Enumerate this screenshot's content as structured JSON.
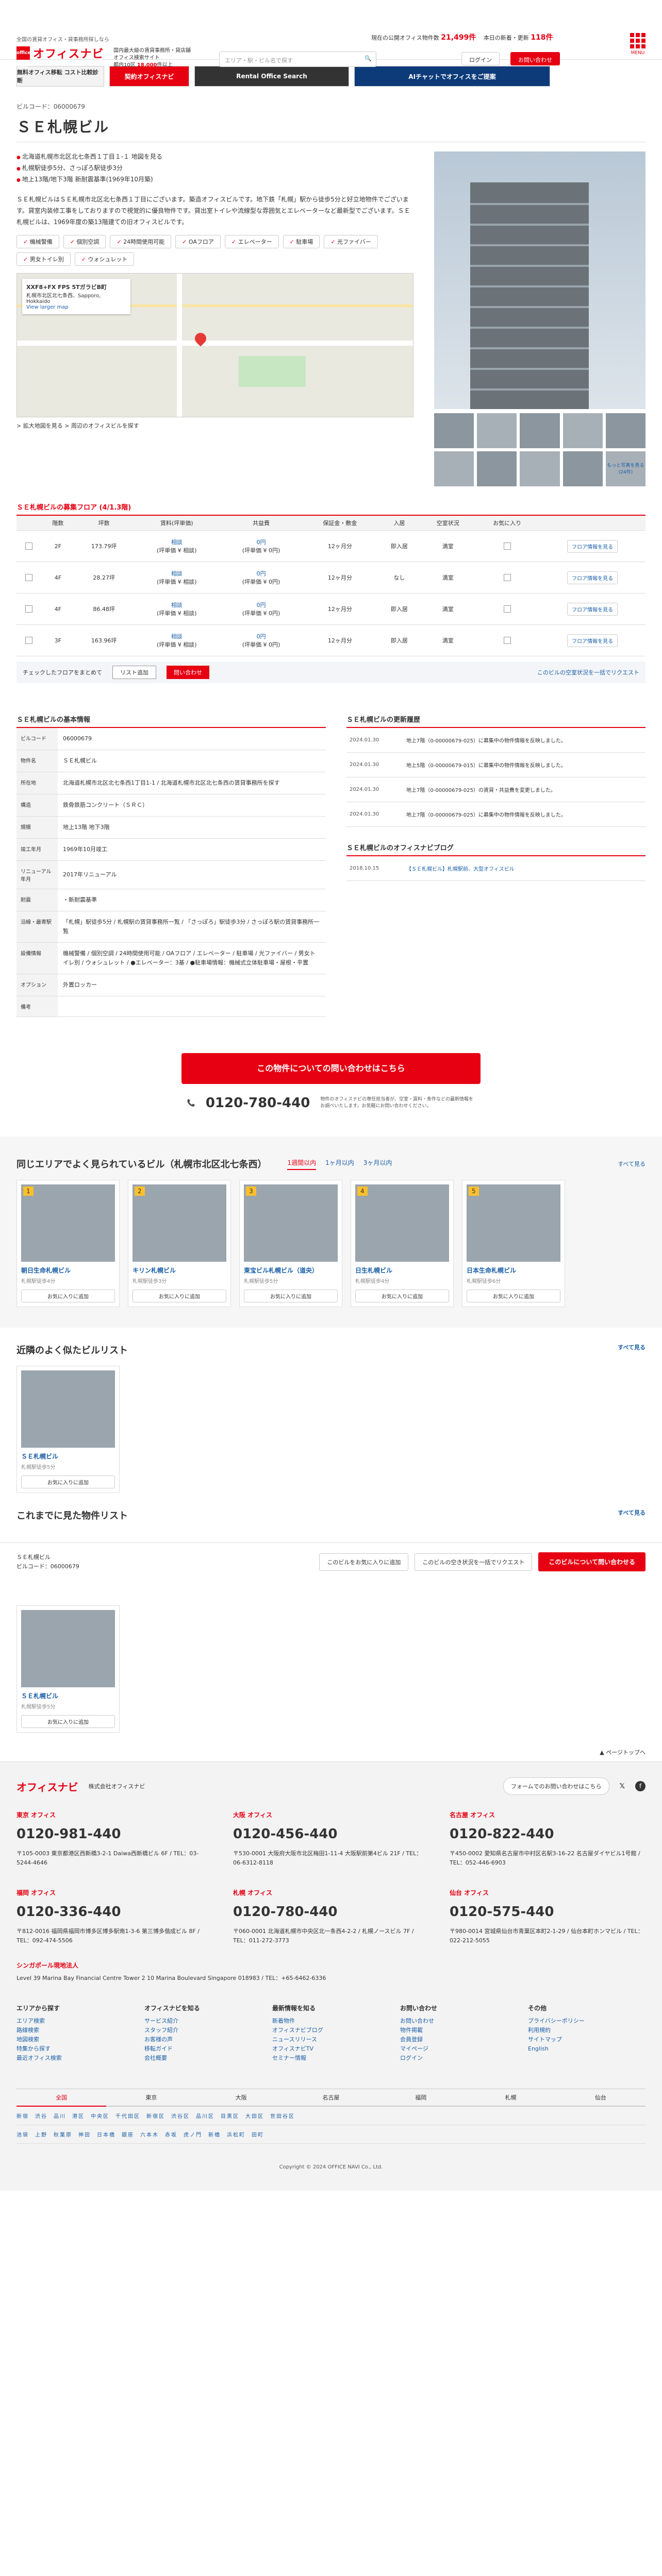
{
  "header": {
    "sub1": "全国の賃貸オフィス・貸事務所探しなら",
    "sub2": "掲載物件数 No.1",
    "logo": "オフィスナビ",
    "logo_box": "office navi",
    "d1": "国内最大級の賃貸事務所・貸店舗",
    "d2": "オフィス検索サイト",
    "d3": "都内10区",
    "d3b": "18,000",
    "d3c": "件以上",
    "search_placeholder": "エリア・駅・ビル名で探す",
    "stat1": "現在の公開オフィス物件数",
    "stat1v": "21,499件",
    "stat2": "本日の新着・更新",
    "stat2v": "118件",
    "login": "ログイン",
    "signup": "お問い合わせ",
    "menu": "MENU"
  },
  "banners": [
    "無料オフィス移転 コスト比較診断",
    "契約オフィスナビ",
    "Rental Office Search",
    "AIチャットでオフィスをご提案"
  ],
  "building": {
    "code_label": "ビルコード：06000679",
    "title": "ＳＥ札幌ビル",
    "addr1": "北海道札幌市北区北七条西１丁目１-１ 地図を見る",
    "addr2": "札幌駅徒歩5分、さっぽろ駅徒歩3分",
    "addr3": "地上13階/地下3階 新耐震基準(1969年10月築)",
    "intro": "ＳＥ札幌ビルはＳＥ札幌市北区北七条西１丁目にございます。築造オフィスビルです。地下鉄「札幌」駅から徒歩5分と好立地物件でございます。貸室内装修工事をしておりますので視覚的に優良物件です。貸出室トイレや流線型な雰囲気とエレベーターなど最新型でございます。ＳＥ札幌ビルは、1969年度の築13階建ての旧オフィスビルです。",
    "features": [
      "機械警備",
      "個別空調",
      "24時間使用可能",
      "OAフロア",
      "エレベーター",
      "駐車場",
      "光ファイバー",
      "男女トイレ別",
      "ウォシュレット"
    ],
    "map_card_title": "XXF8+FX FPS 5TガラビB町",
    "map_card_line": "札幌市北区北七条西、Sapporo, Hokkaido",
    "map_card_link": "View larger map",
    "map_links": "> 拡大地図を見る > 周辺のオフィスビルを探す",
    "thumb_more": "もっと写真を見る(24件)"
  },
  "floors": {
    "heading": "ＳＥ札幌ビルの募集フロア",
    "count": "(4/1.3階)",
    "headers": [
      "",
      "階数",
      "坪数",
      "賃料(坪単価)",
      "共益費",
      "保証金・敷金",
      "入居",
      "空室状況",
      "お気に入り",
      ""
    ],
    "rows": [
      {
        "floor": "2F",
        "area": "173.79坪",
        "rent": "相談",
        "rent_sub": "(坪単価 ¥ 相談)",
        "fee": "0円",
        "fee_sub": "(坪単価 ¥ 0円)",
        "deposit": "12ヶ月分",
        "move": "即入居",
        "status": "満室",
        "detail": "フロア情報を見る"
      },
      {
        "floor": "4F",
        "area": "28.27坪",
        "rent": "相談",
        "rent_sub": "(坪単価 ¥ 相談)",
        "fee": "0円",
        "fee_sub": "(坪単価 ¥ 0円)",
        "deposit": "12ヶ月分",
        "move": "なし",
        "status": "満室",
        "detail": "フロア情報を見る"
      },
      {
        "floor": "4F",
        "area": "86.48坪",
        "rent": "相談",
        "rent_sub": "(坪単価 ¥ 相談)",
        "fee": "0円",
        "fee_sub": "(坪単価 ¥ 0円)",
        "deposit": "12ヶ月分",
        "move": "即入居",
        "status": "満室",
        "detail": "フロア情報を見る"
      },
      {
        "floor": "3F",
        "area": "163.96坪",
        "rent": "相談",
        "rent_sub": "(坪単価 ¥ 相談)",
        "fee": "0円",
        "fee_sub": "(坪単価 ¥ 0円)",
        "deposit": "12ヶ月分",
        "move": "即入居",
        "status": "満室",
        "detail": "フロア情報を見る"
      }
    ],
    "check_label": "チェックしたフロアをまとめて",
    "check_btn1": "リスト追加",
    "check_btn2": "問い合わせ",
    "bulk_link": "このビルの空室状況を一括でリクエスト"
  },
  "info": {
    "heading": "ＳＥ札幌ビルの基本情報",
    "rows": [
      {
        "k": "ビルコード",
        "v": "06000679"
      },
      {
        "k": "物件名",
        "v": "ＳＥ札幌ビル"
      },
      {
        "k": "所在地",
        "v": "北海道札幌市北区北七条西1丁目1-1 / 北海道札幌市北区北七条西の賃貸事務所を探す"
      },
      {
        "k": "構造",
        "v": "鉄骨鉄筋コンクリート（ＳＲＣ）"
      },
      {
        "k": "規模",
        "v": "地上13階 地下3階"
      },
      {
        "k": "竣工年月",
        "v": "1969年10月竣工"
      },
      {
        "k": "リニューアル年月",
        "v": "2017年リニューアル"
      },
      {
        "k": "耐震",
        "v": "・新耐震基準"
      },
      {
        "k": "沿線・最寄駅",
        "v": "「札幌」駅徒歩5分 / 札幌駅の賃貸事務所一覧 / 「さっぽろ」駅徒歩3分 / さっぽろ駅の賃貸事務所一覧"
      },
      {
        "k": "設備情報",
        "v": "機械警備 / 個別空調 / 24時間使用可能 / OAフロア / エレベーター / 駐車場 / 光ファイバー / 男女トイレ別 / ウォシュレット / ●エレベーター：3基 / ●駐車場情報：機械式立体駐車場・屋根・平置"
      },
      {
        "k": "オプション",
        "v": "外置ロッカー"
      },
      {
        "k": "備考",
        "v": ""
      }
    ],
    "log_heading": "ＳＥ札幌ビルの更新履歴",
    "logs": [
      {
        "d": "2024.01.30",
        "t": "地上7階（0-00000679-025）に募集中の物件情報を反映しました。"
      },
      {
        "d": "2024.01.30",
        "t": "地上5階（0-00000679-015）に募集中の物件情報を反映しました。"
      },
      {
        "d": "2024.01.30",
        "t": "地上7階（0-00000679-025）の賃貸・共益費を変更しました。"
      },
      {
        "d": "2024.01.30",
        "t": "地上7階（0-00000679-025）に募集中の物件情報を反映しました。"
      }
    ],
    "blog_heading": "ＳＥ札幌ビルのオフィスナビブログ",
    "blog_date": "2018.10.15",
    "blog_text": "【ＳＥ札幌ビル】札幌駅前、大型オフィスビル"
  },
  "cta": {
    "button": "この物件についての問い合わせはこちら",
    "tel": "0120-780-440",
    "tel_note": "物件のオフィスナビの専任担当者が、空室・賃料・条件などの最新情報をお調べいたします。お気軽にお問い合わせください。"
  },
  "rec": {
    "heading": "同じエリアでよく見られているビル（札幌市北区北七条西）",
    "tabs": [
      "1週間以内",
      "1ヶ月以内",
      "3ヶ月以内"
    ],
    "more": "すべて見る",
    "cards": [
      {
        "n": "1",
        "name": "朝日生命札幌ビル",
        "sub": "札幌駅徒歩4分",
        "fav": "お気に入りに追加"
      },
      {
        "n": "2",
        "name": "キリン札幌ビル",
        "sub": "札幌駅徒歩3分",
        "fav": "お気に入りに追加"
      },
      {
        "n": "3",
        "name": "東宝ビル札幌ビル（道央）",
        "sub": "札幌駅徒歩5分",
        "fav": "お気に入りに追加"
      },
      {
        "n": "4",
        "name": "日生札幌ビル",
        "sub": "札幌駅徒歩4分",
        "fav": "お気に入りに追加"
      },
      {
        "n": "5",
        "name": "日本生命札幌ビル",
        "sub": "札幌駅徒歩6分",
        "fav": "お気に入りに追加"
      }
    ]
  },
  "nearby": {
    "heading": "近隣のよく似たビルリスト",
    "more": "すべて見る",
    "card": {
      "name": "ＳＥ札幌ビル",
      "sub": "札幌駅徒歩5分",
      "fav": "お気に入りに追加"
    }
  },
  "history": {
    "heading": "これまでに見た物件リスト",
    "more": "すべて見る",
    "card": {
      "name": "ＳＥ札幌ビル",
      "sub": "札幌駅徒歩5分",
      "fav": "お気に入りに追加"
    }
  },
  "fixbar": {
    "t1": "ＳＥ札幌ビル",
    "t2": "ビルコード：06000679",
    "b1": "このビルをお気に入りに追加",
    "b2": "このビルの空き状況を一括でリクエスト",
    "b3": "このビルについて問い合わせる"
  },
  "footer": {
    "pagetop": "ページトップへ",
    "cname": "株式会社オフィスナビ",
    "cform": "フォームでのお問い合わせはこちら",
    "offices": [
      {
        "h": "東京 オフィス",
        "tel": "0120-981-440",
        "p": "〒105-0003 東京都港区西新橋3-2-1 Daiwa西新橋ビル 6F / TEL：03-5244-4646"
      },
      {
        "h": "大阪 オフィス",
        "tel": "0120-456-440",
        "p": "〒530-0001 大阪府大阪市北区梅田1-11-4 大阪駅前第4ビル 21F / TEL：06-6312-8118"
      },
      {
        "h": "名古屋 オフィス",
        "tel": "0120-822-440",
        "p": "〒450-0002 愛知県名古屋市中村区名駅3-16-22 名古屋ダイヤビル1号館 / TEL：052-446-6903"
      },
      {
        "h": "福岡 オフィス",
        "tel": "0120-336-440",
        "p": "〒812-0016 福岡県福岡市博多区博多駅南1-3-6 第三博多偕成ビル 8F / TEL：092-474-5506"
      },
      {
        "h": "札幌 オフィス",
        "tel": "0120-780-440",
        "p": "〒060-0001 北海道札幌市中央区北一条西4-2-2 / 札幌ノースビル 7F / TEL：011-272-3773"
      },
      {
        "h": "仙台 オフィス",
        "tel": "0120-575-440",
        "p": "〒980-0014 宮城県仙台市青葉区本町2-1-29 / 仙台本町ホンマビル / TEL：022-212-5055"
      }
    ],
    "sg_h": "シンガポール現地法人",
    "sg_p": "Level 39 Marina Bay Financial Centre Tower 2 10 Marina Boulevard Singapore 018983 / TEL：+65-6462-6336",
    "cols": [
      {
        "h": "エリアから探す",
        "l": [
          "エリア検索",
          "路線検索",
          "地図検索",
          "特集から探す",
          "最近オフィス検索"
        ]
      },
      {
        "h": "オフィスナビを知る",
        "l": [
          "サービス紹介",
          "スタッフ紹介",
          "お客様の声",
          "移転ガイド",
          "会社概要"
        ]
      },
      {
        "h": "最新情報を知る",
        "l": [
          "新着物件",
          "オフィスナビブログ",
          "ニュースリリース",
          "オフィスナビTV",
          "セミナー情報"
        ]
      },
      {
        "h": "お問い合わせ",
        "l": [
          "お問い合わせ",
          "物件掲載",
          "会員登録",
          "マイページ",
          "ログイン"
        ]
      },
      {
        "h": "その他",
        "l": [
          "プライバシーポリシー",
          "利用規約",
          "サイトマップ",
          "English"
        ]
      }
    ],
    "area_tabs": [
      "全国",
      "東京",
      "大阪",
      "名古屋",
      "福岡",
      "札幌",
      "仙台"
    ],
    "area_rows": [
      "新宿　渋谷　品川　港区　中央区　千代田区　新宿区　渋谷区　品川区　目黒区　大田区　世田谷区",
      "池袋　上野　秋葉原　神田　日本橋　銀座　六本木　赤坂　虎ノ門　新橋　浜松町　田町"
    ],
    "copy": "Copyright © 2024 OFFICE NAVI Co., Ltd."
  }
}
